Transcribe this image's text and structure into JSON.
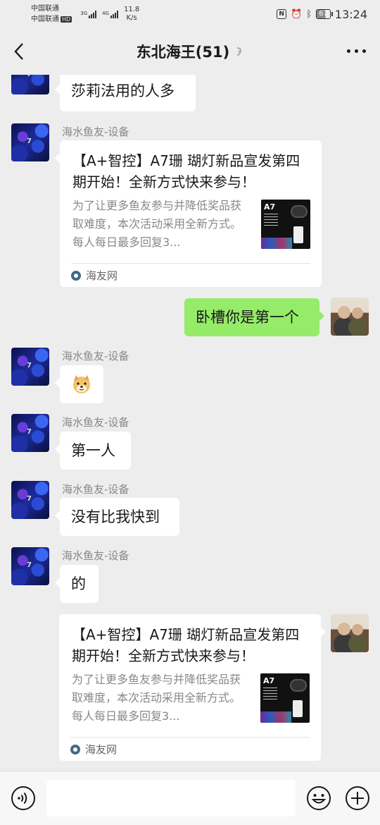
{
  "status_bar": {
    "carrier1": "中国联通",
    "carrier2": "中国联通",
    "carrier2_badge": "HD",
    "net1": "3G",
    "net2": "4G",
    "speed_value": "11.8",
    "speed_unit": "K/s",
    "battery": "67",
    "time": "13:24"
  },
  "header": {
    "title": "东北海王(51)"
  },
  "messages": [
    {
      "text": "莎莉法用的人多"
    },
    {
      "sender": "海水鱼友-设备",
      "card": {
        "title": "【A+智控】A7珊 瑚灯新品宣发第四期开始！全新方式快来参与！",
        "desc": "为了让更多鱼友参与并降低奖品获取难度，本次活动采用全新方式。每人每日最多回复3...",
        "thumb_label": "A7",
        "source": "海友网"
      }
    },
    {
      "text": "卧槽你是第一个"
    },
    {
      "sender": "海水鱼友-设备",
      "sticker": "doge"
    },
    {
      "sender": "海水鱼友-设备",
      "text": "第一人"
    },
    {
      "sender": "海水鱼友-设备",
      "text": "没有比我快到"
    },
    {
      "sender": "海水鱼友-设备",
      "text": "的"
    },
    {
      "card": {
        "title": "【A+智控】A7珊 瑚灯新品宣发第四期开始！全新方式快来参与！",
        "desc": "为了让更多鱼友参与并降低奖品获取难度，本次活动采用全新方式。每人每日最多回复3...",
        "thumb_label": "A7",
        "source": "海友网"
      }
    }
  ],
  "input_bar": {
    "placeholder": ""
  },
  "colors": {
    "background": "#ededed",
    "outgoing_bubble": "#95ec69",
    "incoming_bubble": "#ffffff",
    "sender_name": "#888888"
  },
  "icons": [
    "back-arrow-icon",
    "mute-icon",
    "more-icon",
    "voice-icon",
    "emoji-icon",
    "plus-icon",
    "nfc-icon",
    "alarm-icon",
    "bluetooth-icon"
  ]
}
